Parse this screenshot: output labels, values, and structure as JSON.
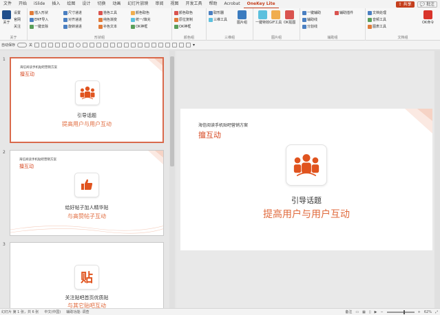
{
  "menu": {
    "tabs": [
      "文件",
      "开始",
      "iSlide",
      "插入",
      "绘图",
      "设计",
      "切换",
      "动画",
      "幻灯片放映",
      "审阅",
      "视图",
      "开发工具",
      "帮助",
      "Acrobat",
      "OneKey Lite"
    ],
    "active_tab": "OneKey Lite",
    "share": "共享",
    "comment": "批注"
  },
  "ribbon": {
    "groups": [
      {
        "label": "关于",
        "items": [
          "关于",
          "设置",
          "官网",
          "关注"
        ]
      },
      {
        "label": "形状组",
        "items": [
          "插入形状",
          "EMF导入",
          "一键去除",
          "尺寸递进",
          "对齐递进",
          "旋转递进",
          "拾色工具",
          "纯色渐变",
          "补色文本",
          "颜色取色",
          "统一/填充",
          "OK神框"
        ]
      },
      {
        "label": "颜色组",
        "items": [
          "颜色取色",
          "原位复制",
          "OK神框"
        ]
      },
      {
        "label": "三维组",
        "items": [
          "取形器",
          "三维工具",
          "图片组"
        ]
      },
      {
        "label": "图片组",
        "items": [
          "一键特效",
          "GIF工具",
          "OK抠图"
        ]
      },
      {
        "label": "辅助组",
        "items": [
          "一键辅助",
          "辅助线",
          "分割线",
          "辅助插件"
        ]
      },
      {
        "label": "文档组",
        "items": [
          "文档处理",
          "音频工具",
          "图表工具",
          "OK命令"
        ]
      }
    ]
  },
  "qat": {
    "autosave_label": "自动保存",
    "autosave_state": "关"
  },
  "slides": [
    {
      "number": "1",
      "small": "海信阅读手机贴吧营销方案",
      "title": "擅互动",
      "line1": "引导话题",
      "line2": "提高用户与用户互动",
      "icon": "group-people-icon",
      "selected": true
    },
    {
      "number": "2",
      "small": "海信阅读手机贴吧营销方案",
      "title": "擅互动",
      "line1": "给好帖子加人精华贴",
      "line2": "与高赞帖子互动",
      "icon": "thumbs-up-icon",
      "selected": false
    },
    {
      "number": "3",
      "small": "",
      "title": "",
      "line1": "关注贴吧首页优质贴",
      "line2": "与其它贴吧互动",
      "icon": "tie-badge-icon",
      "badge_text": "贴",
      "selected": false
    }
  ],
  "main_slide": {
    "small": "海信阅读手机贴吧营销方案",
    "title": "擅互动",
    "line1": "引导话题",
    "line2": "提高用户与用户互动"
  },
  "status": {
    "slide_info": "幻灯片 第 1 张，共 6 张",
    "language": "中文(中国)",
    "accessibility": "辅助功能: 调查",
    "notes": "备注",
    "zoom": "62%"
  },
  "colors": {
    "accent": "#c43e1c",
    "brand_orange": "#e06a3c",
    "title_red": "#d6461f"
  }
}
